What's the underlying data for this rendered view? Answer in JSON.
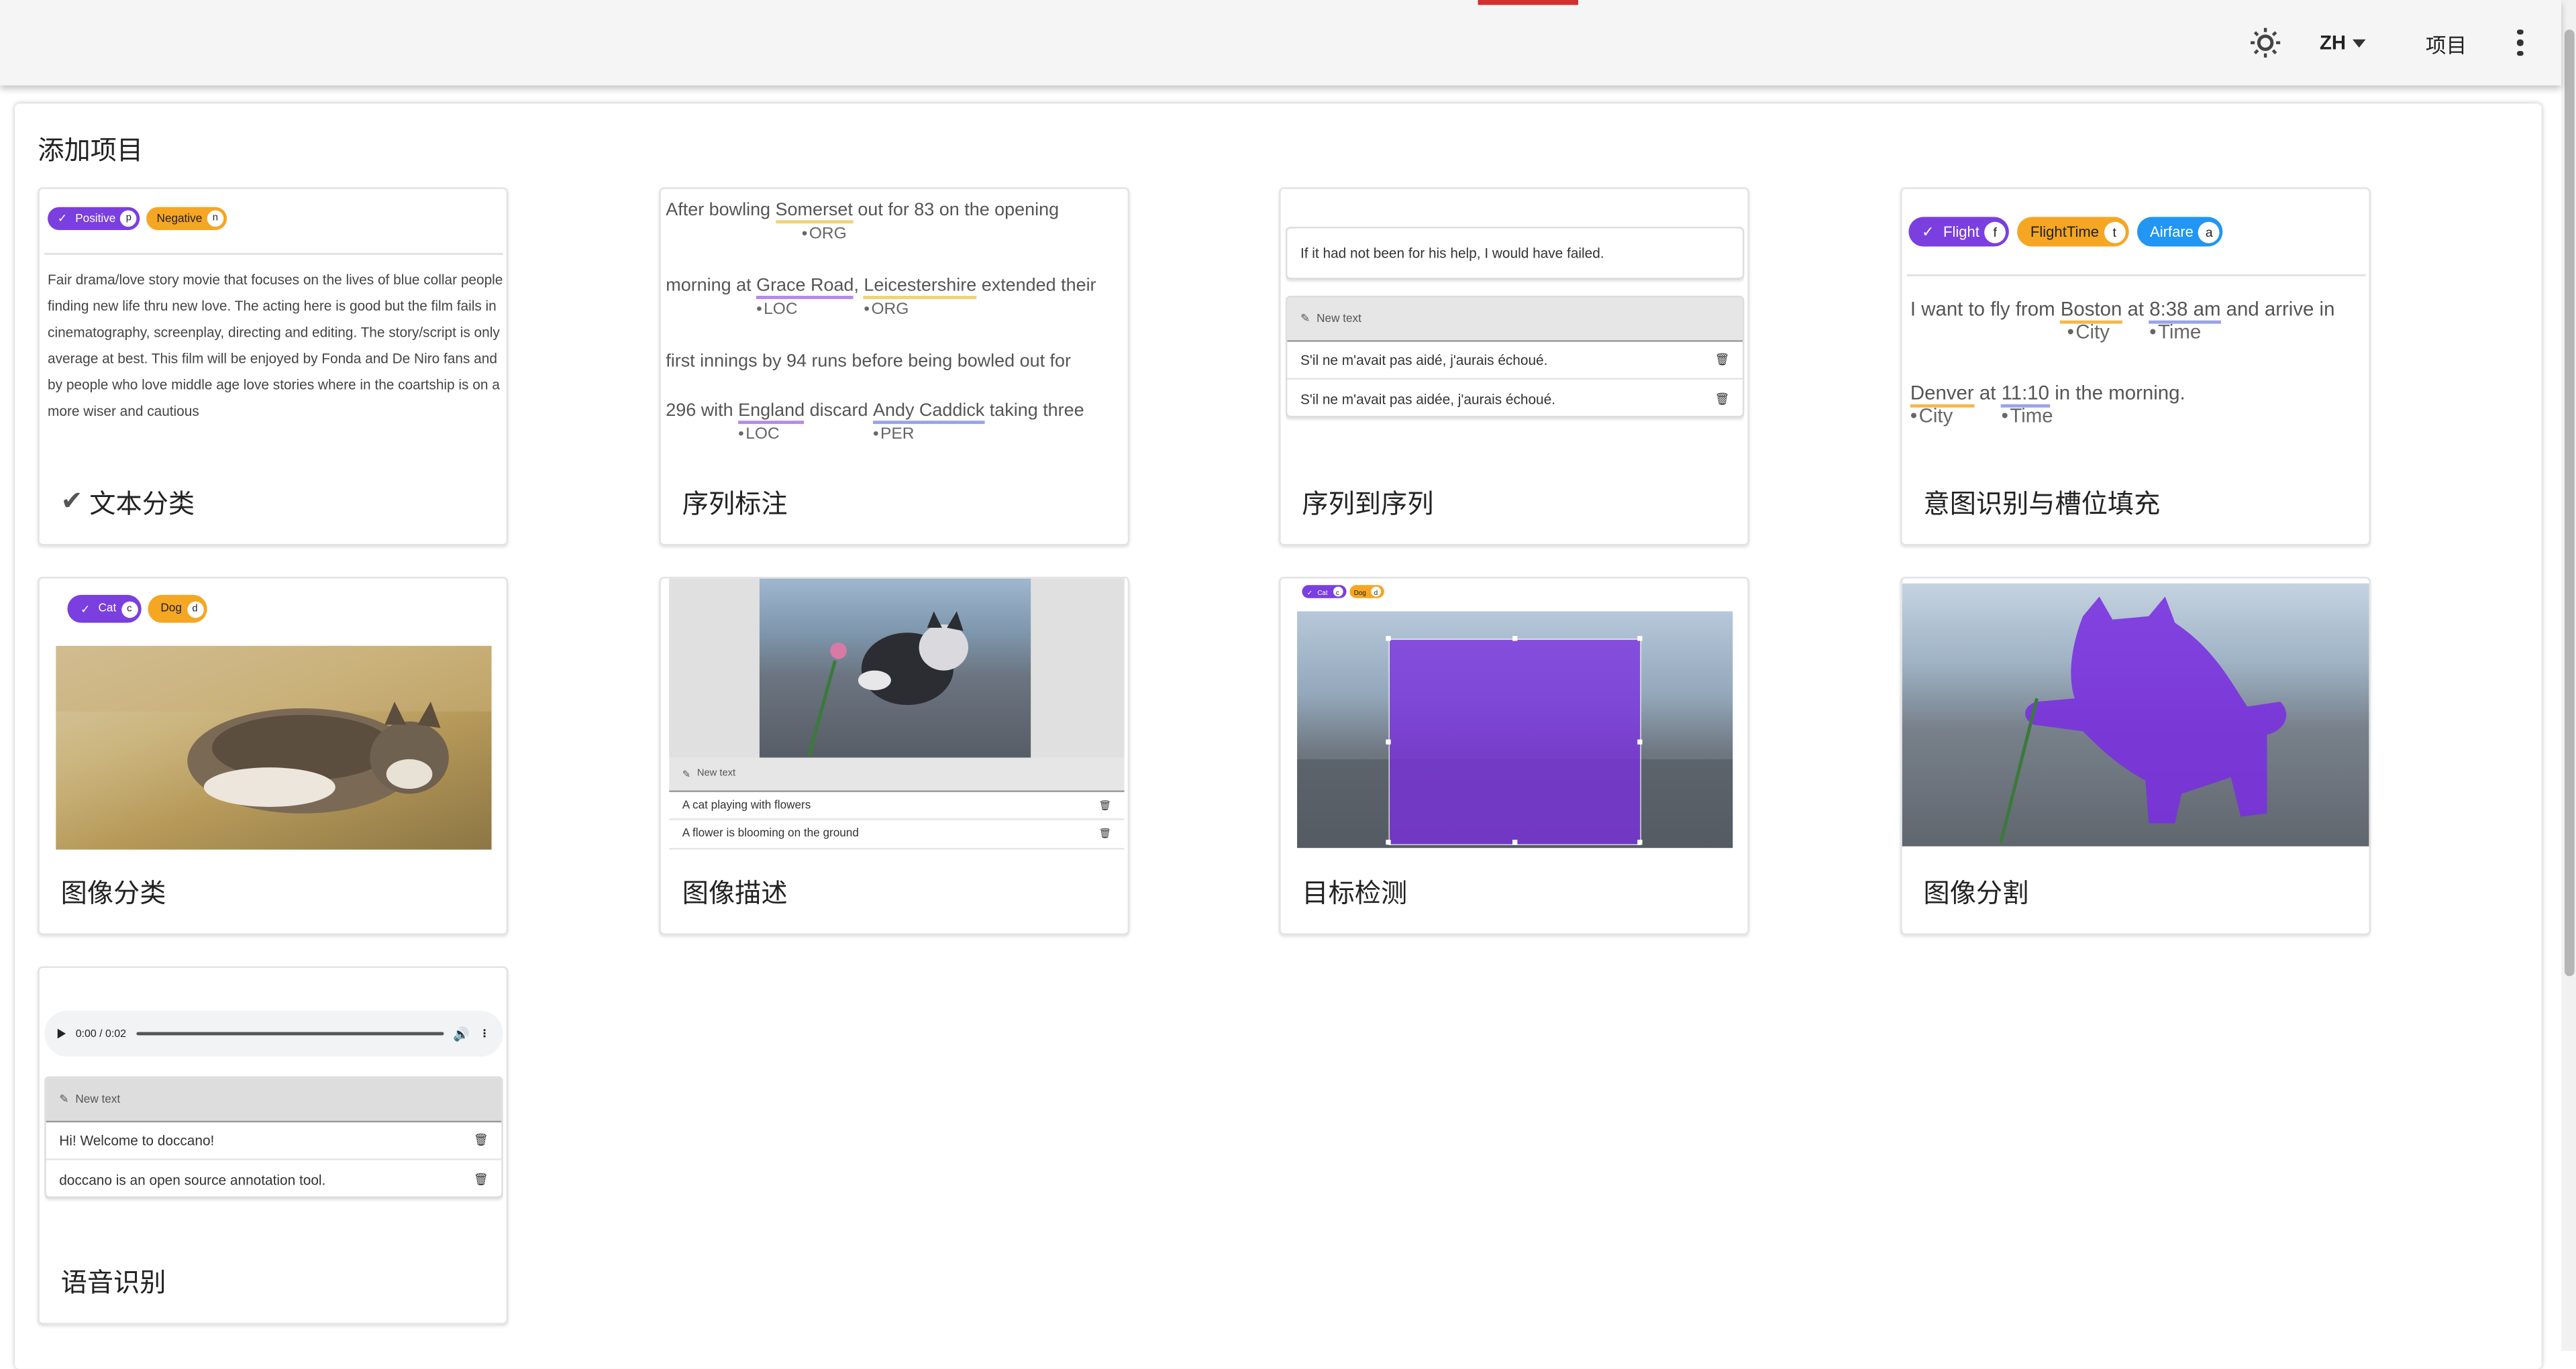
{
  "appbar": {
    "language": "ZH",
    "projects_label": "项目"
  },
  "page": {
    "title": "添加项目"
  },
  "cards": [
    {
      "label": "文本分类",
      "selected": true
    },
    {
      "label": "序列标注"
    },
    {
      "label": "序列到序列"
    },
    {
      "label": "意图识别与槽位填充"
    },
    {
      "label": "图像分类"
    },
    {
      "label": "图像描述"
    },
    {
      "label": "目标检测"
    },
    {
      "label": "图像分割"
    },
    {
      "label": "语音识别"
    }
  ],
  "textcls": {
    "chips": [
      {
        "name": "Positive",
        "key": "p"
      },
      {
        "name": "Negative",
        "key": "n"
      }
    ],
    "text": "Fair drama/love story movie that focuses on the lives of blue collar people finding new life thru new love. The acting here is good but the film fails in cinematography, screenplay, directing and editing. The story/script is only average at best. This film will be enjoyed by Fonda and De Niro fans and by people who love middle age love stories where in the coartship is on a more wiser and cautious"
  },
  "seqlab": {
    "l1a": "After bowling",
    "e1": "Somerset",
    "t1": "ORG",
    "l1b": "out for 83 on the opening",
    "l2a": "morning at",
    "e2": "Grace Road",
    "t2": "LOC",
    "e3": "Leicestershire",
    "t3": "ORG",
    "l2b": "extended their",
    "l3": "first innings by 94 runs before being bowled out for",
    "l4a": "296 with",
    "e4": "England",
    "t4": "LOC",
    "l4b": "discard",
    "e5": "Andy Caddick",
    "t5": "PER",
    "l4c": "taking three"
  },
  "seq2seq": {
    "source": "If it had not been for his help, I would have failed.",
    "new_text": "New text",
    "rows": [
      "S'il ne m'avait pas aidé, j'aurais échoué.",
      "S'il ne m'avait pas aidée, j'aurais échoué."
    ]
  },
  "intent": {
    "chips": [
      {
        "name": "Flight",
        "key": "f"
      },
      {
        "name": "FlightTime",
        "key": "t"
      },
      {
        "name": "Airfare",
        "key": "a"
      }
    ],
    "l1a": "I want to fly from",
    "e1": "Boston",
    "t1": "City",
    "l1b": "at",
    "e2": "8:38 am",
    "t2": "Time",
    "l1c": "and arrive in",
    "e3": "Denver",
    "t3": "City",
    "l2a": "at",
    "e4": "11:10",
    "t4": "Time",
    "l2b": "in the morning."
  },
  "imgcls": {
    "chips": [
      {
        "name": "Cat",
        "key": "c"
      },
      {
        "name": "Dog",
        "key": "d"
      }
    ]
  },
  "caption": {
    "new_text": "New text",
    "rows": [
      "A cat playing with flowers",
      "A flower is blooming on the ground"
    ]
  },
  "detect": {
    "chips": [
      {
        "name": "Cat",
        "key": "c"
      },
      {
        "name": "Dog",
        "key": "d"
      }
    ]
  },
  "audio": {
    "time": "0:00 / 0:02",
    "new_text": "New text",
    "rows": [
      "Hi! Welcome to doccano!",
      "doccano is an open source annotation tool."
    ]
  }
}
